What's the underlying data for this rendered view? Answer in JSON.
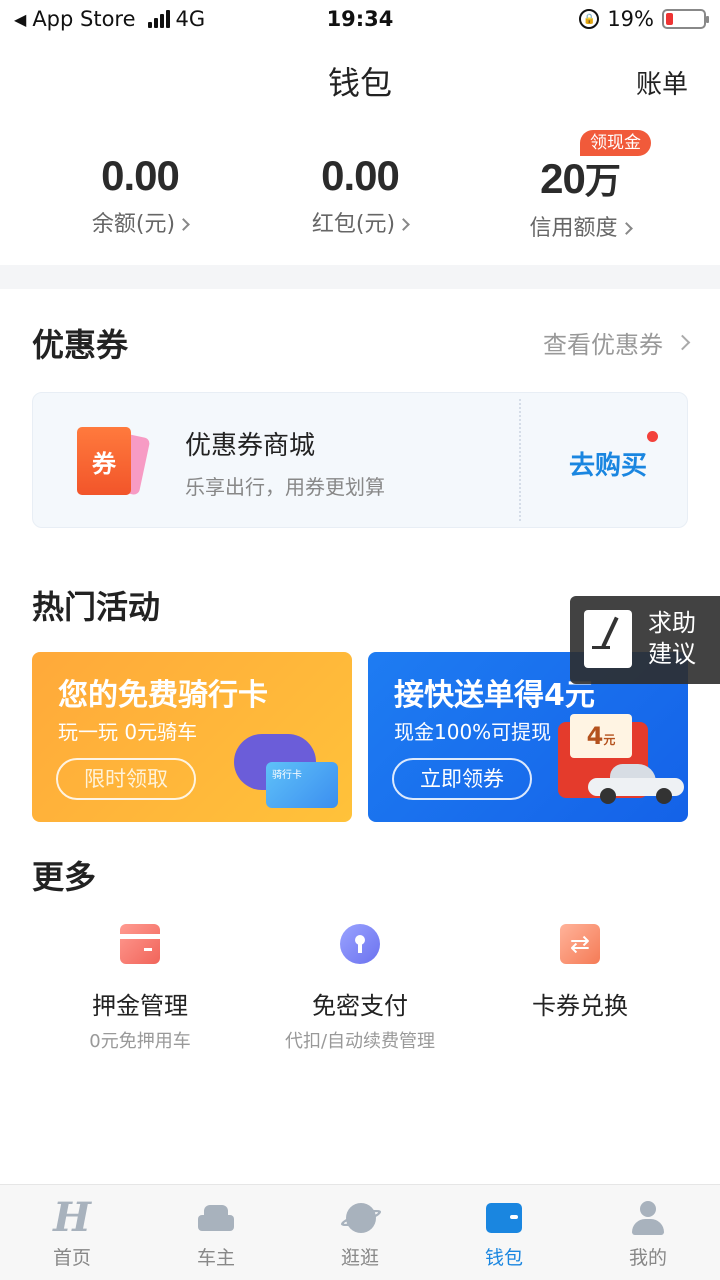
{
  "status_bar": {
    "back_app": "App Store",
    "network": "4G",
    "time": "19:34",
    "battery_percent_label": "19%",
    "battery_level": 0.19
  },
  "header": {
    "title": "钱包",
    "bill_link": "账单"
  },
  "balances": [
    {
      "value": "0.00",
      "label": "余额(元)"
    },
    {
      "value": "0.00",
      "label": "红包(元)"
    },
    {
      "value": "20",
      "unit": "万",
      "label": "信用额度",
      "badge": "领现金"
    }
  ],
  "coupons": {
    "section_title": "优惠券",
    "view_link": "查看优惠券",
    "card": {
      "icon_text": "券",
      "name": "优惠券商城",
      "desc": "乐享出行，用券更划算",
      "action": "去购买"
    }
  },
  "activities": {
    "section_title": "热门活动",
    "cards": [
      {
        "title": "您的免费骑行卡",
        "sub": "玩一玩 0元骑车",
        "button": "限时领取",
        "card_text": "骑行卡"
      },
      {
        "title": "接快送单得4元",
        "sub": "现金100%可提现",
        "button": "立即领券",
        "amount": "4"
      }
    ]
  },
  "floating_help": {
    "line1": "求助",
    "line2": "建议"
  },
  "more": {
    "section_title": "更多",
    "items": [
      {
        "label": "押金管理",
        "sub": "0元免押用车",
        "icon": "deposit-card-icon"
      },
      {
        "label": "免密支付",
        "sub": "代扣/自动续费管理",
        "icon": "keyhole-icon"
      },
      {
        "label": "卡券兑换",
        "sub": "",
        "icon": "exchange-icon"
      }
    ]
  },
  "tabbar": {
    "items": [
      {
        "label": "首页",
        "icon": "home-icon"
      },
      {
        "label": "车主",
        "icon": "car-icon"
      },
      {
        "label": "逛逛",
        "icon": "planet-icon"
      },
      {
        "label": "钱包",
        "icon": "wallet-icon",
        "active": true
      },
      {
        "label": "我的",
        "icon": "user-icon"
      }
    ]
  },
  "colors": {
    "accent": "#1a86e0",
    "badge": "#f15a3a",
    "promo_orange": "#ffb03a",
    "promo_blue": "#1a70ee"
  }
}
